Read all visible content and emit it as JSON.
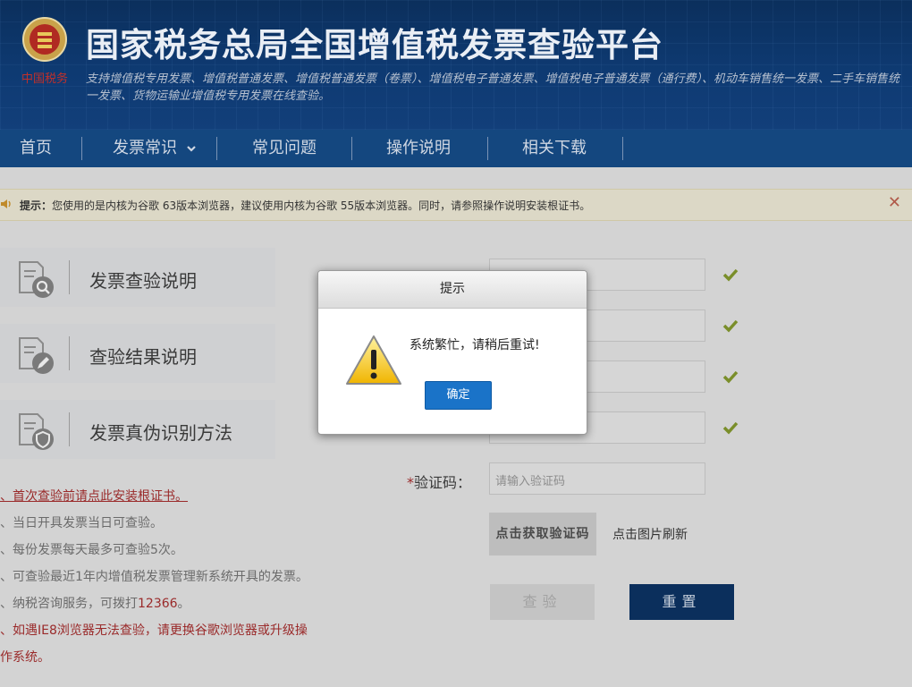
{
  "header": {
    "emblem_text": "中国税务",
    "title": "国家税务总局全国增值税发票查验平台",
    "subtitle": "支持增值税专用发票、增值税普通发票、增值税普通发票（卷票）、增值税电子普通发票、增值税电子普通发票（通行费）、机动车销售统一发票、二手车销售统一发票、货物运输业增值税专用发票在线查验。"
  },
  "nav": {
    "items": [
      {
        "label": "首页"
      },
      {
        "label": "发票常识"
      },
      {
        "label": "常见问题"
      },
      {
        "label": "操作说明"
      },
      {
        "label": "相关下载"
      }
    ],
    "dropdown_icon": "chevron-down-icon"
  },
  "notice": {
    "prefix": "提示：",
    "text": "您使用的是内核为谷歌 63版本浏览器，建议使用内核为谷歌 55版本浏览器。同时，请参照操作说明安装根证书。",
    "close_glyph": "✕"
  },
  "sidebar": {
    "cards": [
      {
        "label": "发票查验说明",
        "icon": "document-search-icon"
      },
      {
        "label": "查验结果说明",
        "icon": "document-edit-icon"
      },
      {
        "label": "发票真伪识别方法",
        "icon": "document-shield-icon"
      }
    ]
  },
  "tips": {
    "tip1": "、首次查验前请点此安装根证书。",
    "tip2": "、当日开具发票当日可查验。",
    "tip3": "、每份发票每天最多可查验5次。",
    "tip4": "、可查验最近1年内增值税发票管理新系统开具的发票。",
    "tip5_prefix": "、纳税咨询服务，可拨打",
    "tip5_phone": "12366",
    "tip5_suffix": "。",
    "tip6a": "、如遇IE8浏览器无法查验，请更换谷歌浏览器或升级操",
    "tip6b": "作系统。"
  },
  "form": {
    "captcha_required_mark": "*",
    "captcha_label": "验证码：",
    "captcha_placeholder": "请输入验证码",
    "captcha_image_text": "点击获取验证码",
    "refresh_text": "点击图片刷新",
    "query_button": "查验",
    "reset_button": "重置"
  },
  "dialog": {
    "title": "提示",
    "message": "系统繁忙，请稍后重试!",
    "ok_button": "确定"
  },
  "colors": {
    "header_bg": "#0e3a72",
    "nav_bg": "#14477f",
    "ok_button": "#1a73c8",
    "reset_button": "#0b2f5c",
    "check_green": "#7a8e2a",
    "tip_red": "#9a2a2a"
  }
}
